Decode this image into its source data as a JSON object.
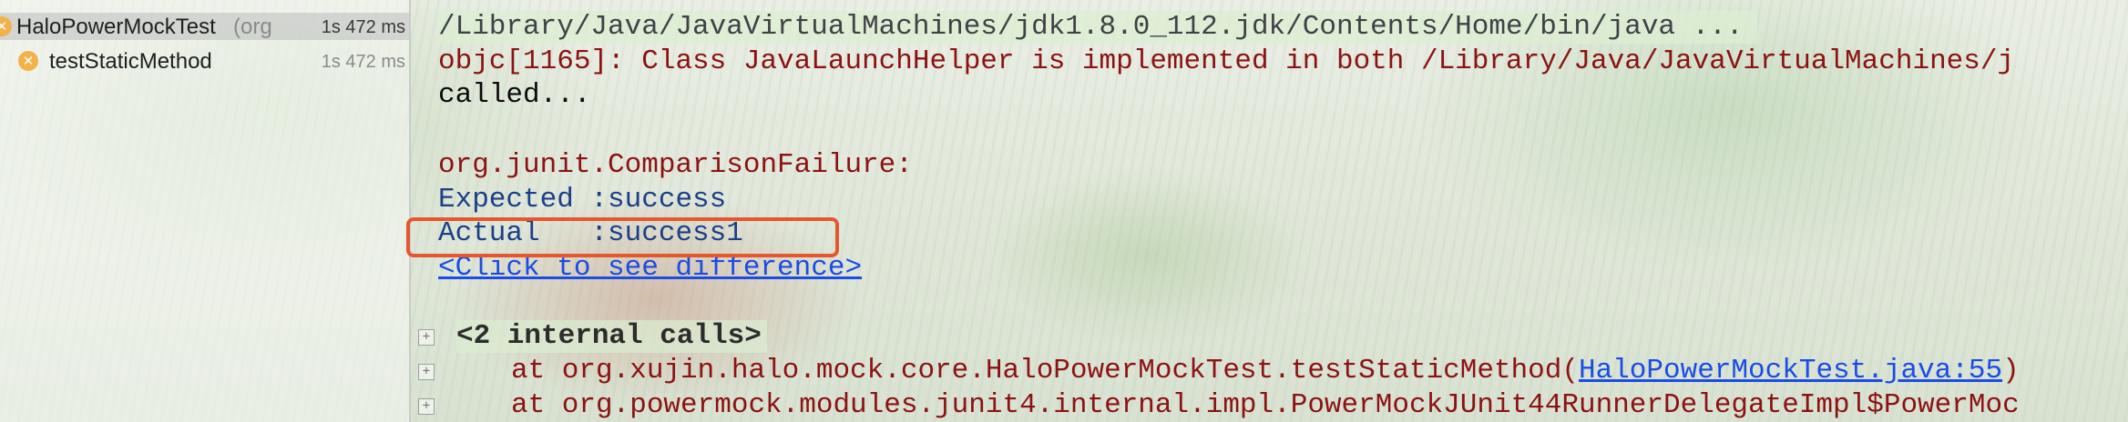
{
  "test_tree": {
    "root": {
      "name": "HaloPowerMockTest",
      "package": "(org",
      "time": "1s 472 ms",
      "status_icon": "warning-icon"
    },
    "child": {
      "name": "testStaticMethod",
      "time": "1s 472 ms",
      "status_icon": "warning-icon"
    }
  },
  "console": {
    "java_cmd": "/Library/Java/JavaVirtualMachines/jdk1.8.0_112.jdk/Contents/Home/bin/java ...",
    "objc_warning": "objc[1165]: Class JavaLaunchHelper is implemented in both /Library/Java/JavaVirtualMachines/j",
    "called": "called...",
    "failure": "org.junit.ComparisonFailure:",
    "expected": "Expected :success",
    "actual": "Actual   :success1",
    "diff_link": "<Click to see difference>",
    "internal_calls": "<2 internal calls>",
    "stack1_prefix": "at org.xujin.halo.mock.core.HaloPowerMockTest.testStaticMethod(",
    "stack1_link": "HaloPowerMockTest.java:55",
    "stack1_suffix": ")",
    "stack2": "at org.powermock.modules.junit4.internal.impl.PowerMockJUnit44RunnerDelegateImpl$PowerMoc"
  },
  "colors": {
    "highlight_border": "#e5572e",
    "error_text": "#8b1313",
    "link": "#1a4ce6",
    "warning_icon": "#f3b14a"
  }
}
